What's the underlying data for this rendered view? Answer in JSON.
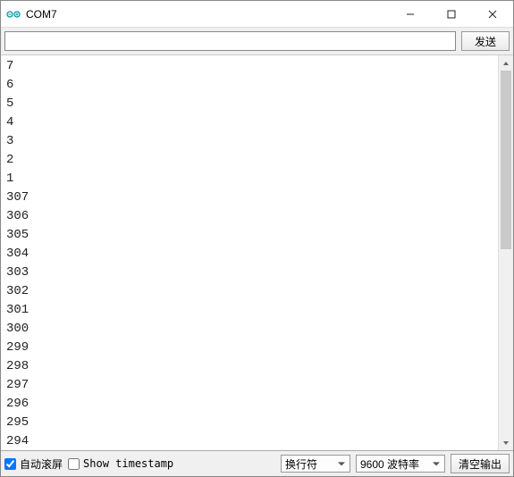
{
  "window": {
    "title": "COM7"
  },
  "input_bar": {
    "value": "",
    "send_label": "发送"
  },
  "console_lines": [
    "7",
    "6",
    "5",
    "4",
    "3",
    "2",
    "1",
    "307",
    "306",
    "305",
    "304",
    "303",
    "302",
    "301",
    "300",
    "299",
    "298",
    "297",
    "296",
    "295",
    "294"
  ],
  "status": {
    "autoscroll": {
      "label": "自动滚屏",
      "checked": true
    },
    "show_timestamp": {
      "label": "Show timestamp",
      "checked": false
    },
    "line_ending": "换行符",
    "baud": "9600 波特率",
    "clear_label": "清空输出"
  }
}
